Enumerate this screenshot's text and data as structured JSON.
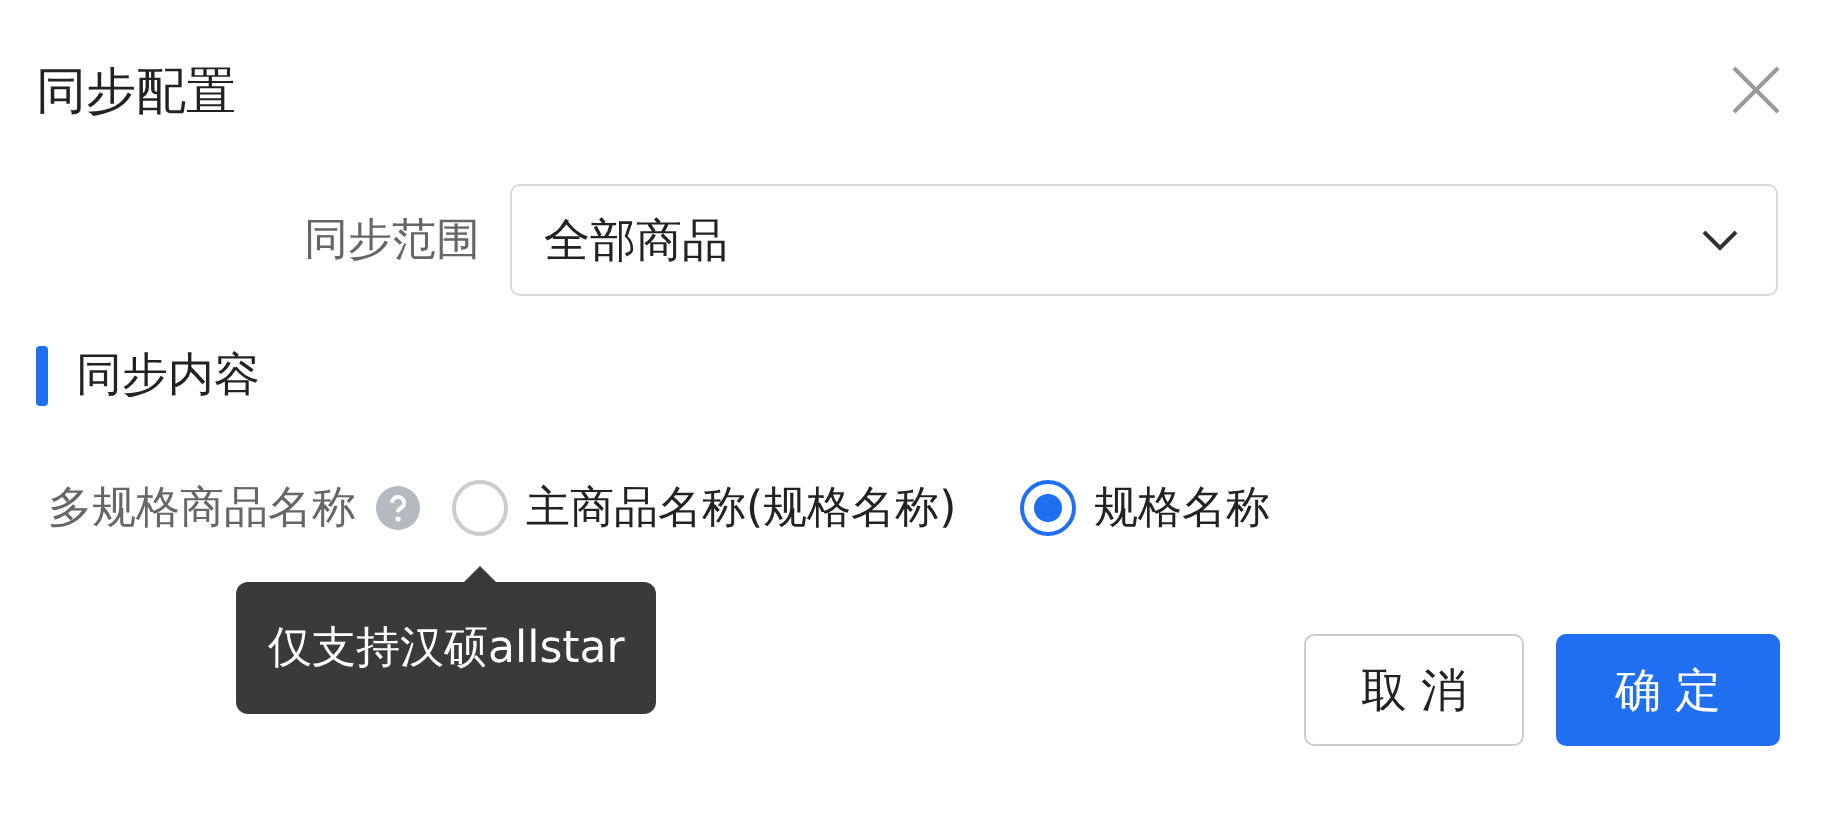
{
  "dialog": {
    "title": "同步配置"
  },
  "scope": {
    "label": "同步范围",
    "value": "全部商品"
  },
  "section": {
    "title": "同步内容"
  },
  "name_option": {
    "label": "多规格商品名称",
    "tooltip": "仅支持汉硕allstar",
    "options": [
      {
        "label": "主商品名称(规格名称)",
        "selected": false
      },
      {
        "label": "规格名称",
        "selected": true
      }
    ]
  },
  "buttons": [
    {
      "label": "取 消",
      "kind": "default"
    },
    {
      "label": "确 定",
      "kind": "primary"
    }
  ]
}
